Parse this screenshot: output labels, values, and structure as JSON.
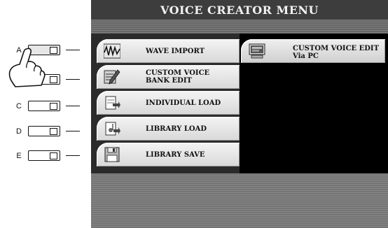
{
  "hardware_buttons": [
    {
      "letter": "A",
      "pressed": true
    },
    {
      "letter": "",
      "pressed": false
    },
    {
      "letter": "C",
      "pressed": false
    },
    {
      "letter": "D",
      "pressed": false
    },
    {
      "letter": "E",
      "pressed": false
    }
  ],
  "screen": {
    "title": "VOICE CREATOR MENU",
    "left_menu": [
      {
        "label": "WAVE IMPORT",
        "icon": "waveform-icon"
      },
      {
        "label": "CUSTOM VOICE\nBANK EDIT",
        "icon": "bank-edit-icon"
      },
      {
        "label": "INDIVIDUAL LOAD",
        "icon": "individual-load-icon"
      },
      {
        "label": "LIBRARY LOAD",
        "icon": "library-load-icon"
      },
      {
        "label": "LIBRARY SAVE",
        "icon": "floppy-save-icon"
      }
    ],
    "right_menu": [
      {
        "label": "CUSTOM VOICE EDIT\nVia PC",
        "icon": "pc-monitor-icon"
      }
    ]
  },
  "colors": {
    "title_bar": "#3d3d3d",
    "panel": "#2b2b2b",
    "tab": "#e6e6e6"
  }
}
